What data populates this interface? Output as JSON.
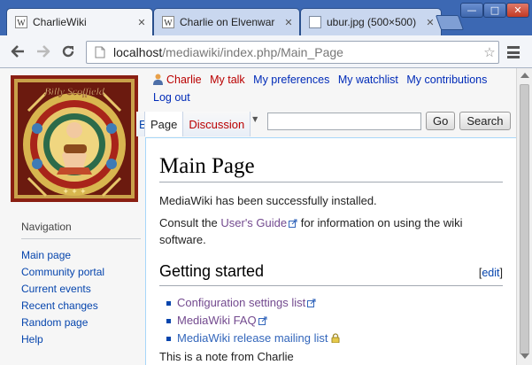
{
  "browser": {
    "tabs": [
      {
        "title": "CharlieWiki",
        "active": true
      },
      {
        "title": "Charlie on Elvenwar",
        "active": false
      },
      {
        "title": "ubur.jpg (500×500)",
        "active": false
      }
    ],
    "url_host": "localhost",
    "url_path": "/mediawiki/index.php/Main_Page",
    "window_buttons": {
      "minimize": "—",
      "maximize": "□",
      "close": "✕"
    },
    "tab_close_glyph": "✕",
    "icons": [
      "back-icon",
      "forward-icon",
      "reload-icon",
      "page-icon",
      "star-icon",
      "menu-icon"
    ]
  },
  "wiki": {
    "logo": {
      "caption": "Billy Scoffield"
    },
    "personal": {
      "user": "Charlie",
      "talk": "My talk",
      "preferences": "My preferences",
      "watchlist": "My watchlist",
      "contributions": "My contributions",
      "logout": "Log out"
    },
    "tabs": {
      "cut_label": "E",
      "page": "Page",
      "discussion": "Discussion"
    },
    "search": {
      "placeholder": "",
      "go": "Go",
      "search": "Search"
    },
    "content": {
      "title": "Main Page",
      "intro": "MediaWiki has been successfully installed.",
      "consult_before": "Consult the ",
      "users_guide": "User's Guide",
      "consult_after": " for information on using the wiki software.",
      "section_title": "Getting started",
      "edit_open": "[",
      "edit_label": "edit",
      "edit_close": "]",
      "links": [
        {
          "label": "Configuration settings list",
          "icon": "external-link-icon"
        },
        {
          "label": "MediaWiki FAQ",
          "icon": "external-link-icon"
        },
        {
          "label": "MediaWiki release mailing list",
          "icon": "lock-icon"
        }
      ],
      "note": "This is a note from Charlie"
    },
    "navigation": {
      "heading": "Navigation",
      "items": [
        "Main page",
        "Community portal",
        "Current events",
        "Recent changes",
        "Random page",
        "Help"
      ]
    }
  },
  "colors": {
    "link": "#0645ad",
    "visited": "#734a8f",
    "redlink": "#ba0000",
    "chrome_blue": "#3c68b3"
  }
}
